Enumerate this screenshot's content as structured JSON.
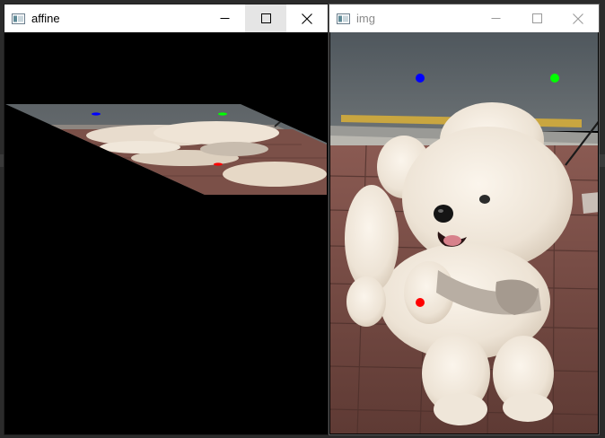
{
  "windows": {
    "affine": {
      "title": "affine",
      "icon": "opencv-window-icon",
      "controls": [
        "minimize",
        "maximize",
        "close"
      ]
    },
    "img": {
      "title": "img",
      "icon": "opencv-window-icon",
      "controls": [
        "minimize",
        "maximize",
        "close"
      ]
    }
  },
  "colors": {
    "point_blue": "#0000ff",
    "point_green": "#00ff00",
    "point_red": "#ff0000",
    "canvas_bg": "#000000"
  }
}
